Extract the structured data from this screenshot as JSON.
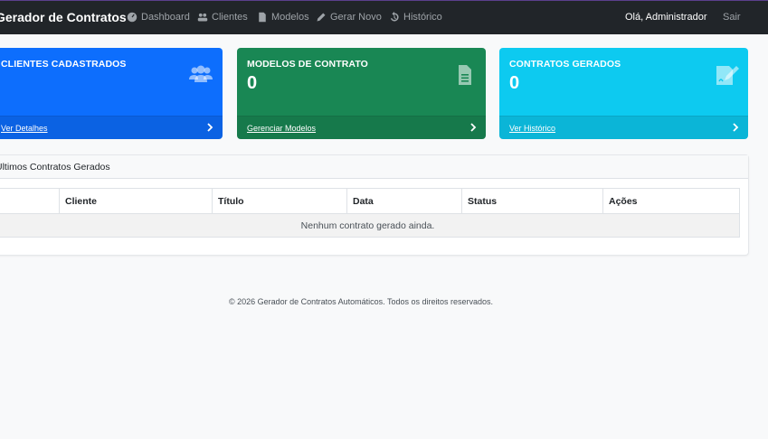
{
  "navbar": {
    "brand": "Gerador de Contratos",
    "items": [
      {
        "label": "Dashboard",
        "icon": "tachometer-icon"
      },
      {
        "label": "Clientes",
        "icon": "users-icon"
      },
      {
        "label": "Modelos",
        "icon": "file-icon"
      },
      {
        "label": "Gerar Novo",
        "icon": "pencil-icon"
      },
      {
        "label": "Histórico",
        "icon": "history-icon"
      }
    ],
    "greeting": "Olá, Administrador",
    "logout": "Sair"
  },
  "cards": [
    {
      "title": "CLIENTES CADASTRADOS",
      "count": "",
      "link": "Ver Detalhes",
      "color": "#0d6efd",
      "icon": "users-icon"
    },
    {
      "title": "MODELOS DE CONTRATO",
      "count": "0",
      "link": "Gerenciar Modelos",
      "color": "#198754",
      "icon": "file-icon"
    },
    {
      "title": "CONTRATOS GERADOS",
      "count": "0",
      "link": "Ver Histórico",
      "color": "#0dcaf0",
      "icon": "signature-icon"
    }
  ],
  "recent": {
    "title": "Últimos Contratos Gerados",
    "columns": [
      "#",
      "Cliente",
      "Título",
      "Data",
      "Status",
      "Ações"
    ],
    "empty_message": "Nenhum contrato gerado ainda."
  },
  "footer": "© 2026 Gerador de Contratos Automáticos. Todos os direitos reservados."
}
